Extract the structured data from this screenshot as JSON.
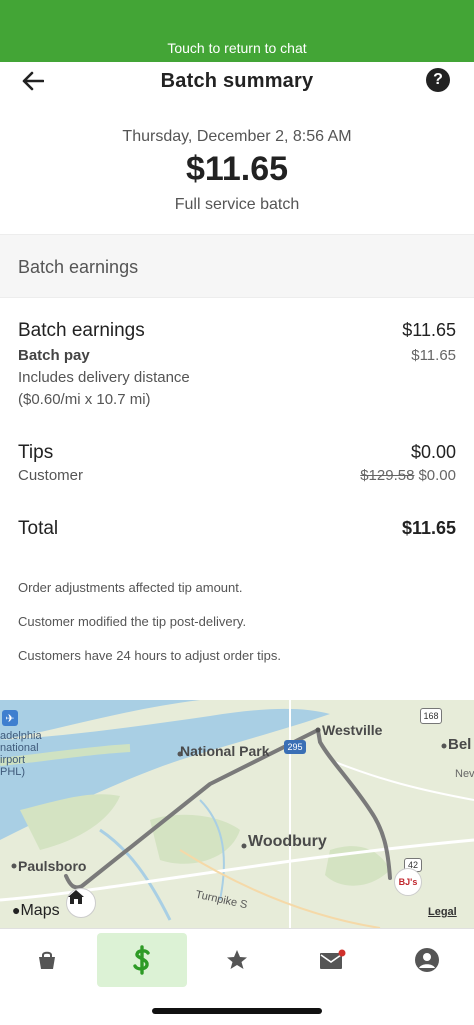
{
  "banner": {
    "text": "Touch to return to chat"
  },
  "header": {
    "title": "Batch summary",
    "help_label": "?"
  },
  "summary": {
    "date": "Thursday, December 2, 8:56 AM",
    "amount": "$11.65",
    "batch_type": "Full service batch"
  },
  "section": {
    "title": "Batch earnings"
  },
  "earnings": {
    "label": "Batch earnings",
    "amount": "$11.65",
    "batch_pay_label": "Batch pay",
    "batch_pay_amount": "$11.65",
    "distance_line1": "Includes delivery distance",
    "distance_line2": "($0.60/mi x 10.7 mi)"
  },
  "tips": {
    "label": "Tips",
    "amount": "$0.00",
    "customer_label": "Customer",
    "customer_original": "$129.58",
    "customer_amount": "$0.00"
  },
  "total": {
    "label": "Total",
    "amount": "$11.65"
  },
  "notes": [
    "Order adjustments affected tip amount.",
    "Customer modified the tip post-delivery.",
    "Customers have 24 hours to adjust order tips."
  ],
  "map": {
    "labels": {
      "westville": "Westville",
      "national_park": "National Park",
      "woodbury": "Woodbury",
      "paulsboro": "Paulsboro",
      "bel": "Bel",
      "airport1": "adelphia",
      "airport2": "national",
      "airport3": "irport",
      "airport4": "PHL)",
      "turnpike": "Turnpike S",
      "nev": "Nev",
      "route168": "168",
      "route295": "295",
      "route42": "42",
      "store": "BJ's"
    },
    "maps_brand": "Maps",
    "legal": "Legal"
  },
  "tabs": [
    {
      "name": "shop",
      "icon": "shopping-bag-icon"
    },
    {
      "name": "earnings",
      "icon": "dollar-icon",
      "active": true
    },
    {
      "name": "ratings",
      "icon": "star-icon"
    },
    {
      "name": "messages",
      "icon": "mail-icon",
      "badge": true
    },
    {
      "name": "account",
      "icon": "account-icon"
    }
  ],
  "colors": {
    "banner": "#43a536",
    "accent": "#2e9b26",
    "active_tab_bg": "#dcf2d5",
    "badge": "#d0302b"
  }
}
